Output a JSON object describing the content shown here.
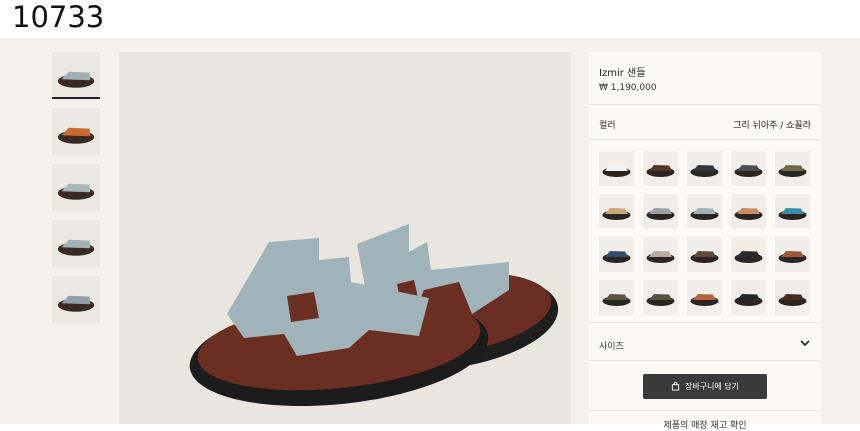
{
  "header": {
    "id_text": "10733"
  },
  "thumbnails": [
    {
      "name": "thumb-1",
      "color": "#9fb1b5",
      "active": true
    },
    {
      "name": "thumb-2",
      "color": "#c8692f",
      "active": false
    },
    {
      "name": "thumb-3",
      "color": "#a9b6b7",
      "active": false
    },
    {
      "name": "thumb-4",
      "color": "#a3b2b4",
      "active": false
    },
    {
      "name": "thumb-5",
      "color": "#8fa1a6",
      "active": false
    }
  ],
  "product": {
    "title": "Izmir 샌들",
    "price": "₩ 1,190,000",
    "main_color": "#9fb3b8",
    "sole_color": "#6b2e22"
  },
  "color_option": {
    "label": "컬러",
    "selected_value": "그리 뉘아주 / 쇼꼴라"
  },
  "swatches": [
    {
      "color": "#f4f4f2",
      "selected": false
    },
    {
      "color": "#5a3526",
      "selected": false
    },
    {
      "color": "#2f3640",
      "selected": false
    },
    {
      "color": "#4b5052",
      "selected": false
    },
    {
      "color": "#6e6b4a",
      "selected": false
    },
    {
      "color": "#c9a57c",
      "selected": false
    },
    {
      "color": "#9aa2a4",
      "selected": false
    },
    {
      "color": "#9fb3b8",
      "selected": true
    },
    {
      "color": "#c98c5a",
      "selected": false
    },
    {
      "color": "#3a8ea8",
      "selected": false
    },
    {
      "color": "#2f4f6a",
      "selected": false
    },
    {
      "color": "#b7aea3",
      "selected": false
    },
    {
      "color": "#5f4a3a",
      "selected": false
    },
    {
      "color": "#2b2b2b",
      "selected": false
    },
    {
      "color": "#a0563a",
      "selected": false
    },
    {
      "color": "#5d5546",
      "selected": false
    },
    {
      "color": "#55533f",
      "selected": false
    },
    {
      "color": "#b5673a",
      "selected": false
    },
    {
      "color": "#262626",
      "selected": false
    },
    {
      "color": "#4a2a20",
      "selected": false
    }
  ],
  "size_option": {
    "label": "사이즈"
  },
  "actions": {
    "add_to_cart": "장바구니에 담기",
    "store_availability": "제품의 매장 재고 확인"
  }
}
